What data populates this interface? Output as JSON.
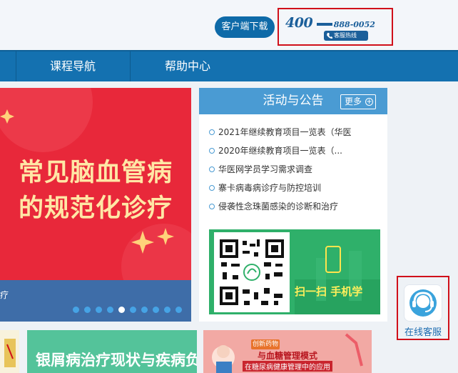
{
  "header": {
    "client_download": "客户端下载",
    "hotline": {
      "prefix": "400",
      "number": "888-0052",
      "label": "客服热线"
    }
  },
  "nav": {
    "items": [
      "课程导航",
      "帮助中心"
    ]
  },
  "banner": {
    "line1": "常见脑血管病",
    "line2": "的规范化诊疗",
    "caption_fragment": "疗",
    "slides_total": 10,
    "active_slide": 5
  },
  "announcements": {
    "title": "活动与公告",
    "more_label": "更多",
    "items": [
      "2021年继续教育项目一览表（华医",
      "2020年继续教育项目一览表（...",
      "华医网学员学习需求调查",
      "寨卡病毒病诊疗与防控培训",
      "侵袭性念珠菌感染的诊断和治疗"
    ]
  },
  "promo": {
    "text": "扫一扫 手机学"
  },
  "service": {
    "label": "在线客服"
  },
  "cards": {
    "green_title": "银屑病治疗现状与疾病负担",
    "red_tag": "创新药物",
    "red_title": "与血糖管理模式",
    "red_subtitle": "在糖尿病健康管理中的应用"
  },
  "colors": {
    "brand_blue": "#1471b0",
    "banner_red": "#e8283a",
    "highlight_red": "#d0101a",
    "promo_green": "#2fb06a"
  }
}
